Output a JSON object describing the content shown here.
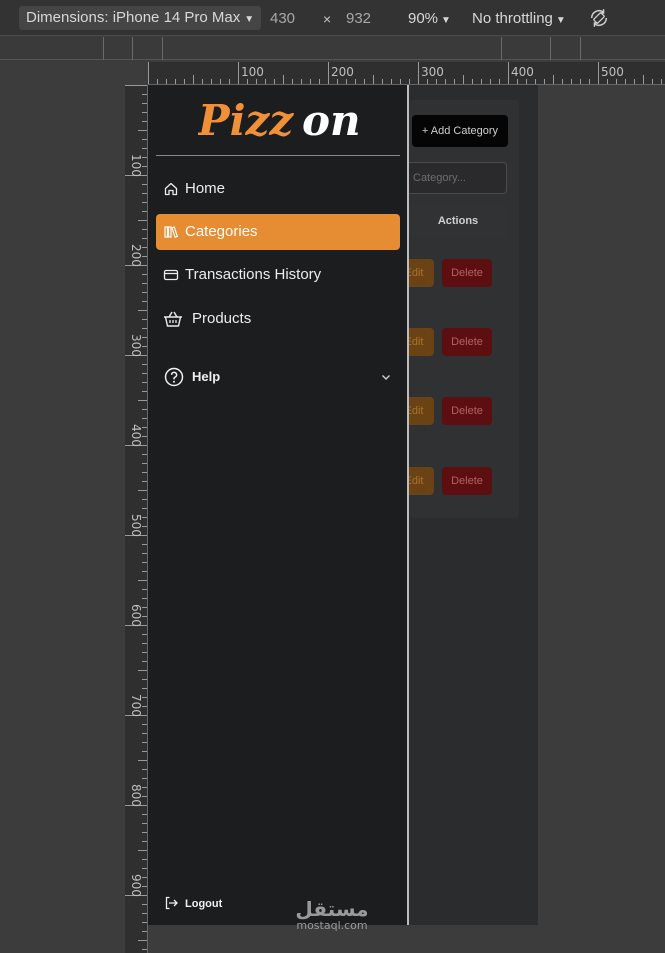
{
  "devtools": {
    "device_label": "Dimensions: iPhone 14 Pro Max",
    "width": "430",
    "times": "×",
    "height": "932",
    "zoom": "90%",
    "throttling": "No throttling"
  },
  "ruler": {
    "h_labels": [
      "100",
      "200",
      "300",
      "400",
      "500"
    ],
    "v_labels": [
      "100",
      "200",
      "300",
      "400",
      "500",
      "600",
      "700",
      "800",
      "900"
    ]
  },
  "background_page": {
    "add_category": "+ Add Category",
    "search_placeholder": "Category...",
    "actions_header": "Actions",
    "rows": [
      {
        "edit": "Edit",
        "delete": "Delete"
      },
      {
        "edit": "Edit",
        "delete": "Delete"
      },
      {
        "edit": "Edit",
        "delete": "Delete"
      },
      {
        "edit": "Edit",
        "delete": "Delete"
      }
    ]
  },
  "sidebar": {
    "logo": {
      "part1": "Pizz",
      "part2": "on",
      "color1": "#f0913a",
      "color2": "#ffffff"
    },
    "items": [
      {
        "label": "Home",
        "icon": "home-icon",
        "active": false
      },
      {
        "label": "Categories",
        "icon": "books-icon",
        "active": true
      },
      {
        "label": "Transactions History",
        "icon": "card-icon",
        "active": false
      },
      {
        "label": "Products",
        "icon": "basket-icon",
        "active": false
      }
    ],
    "help": {
      "label": "Help",
      "icon": "help-icon"
    },
    "logout": {
      "label": "Logout",
      "icon": "logout-icon"
    },
    "accent": "#e68c33"
  },
  "watermark": {
    "arabic": "مستقل",
    "latin": "mostaql.com"
  }
}
